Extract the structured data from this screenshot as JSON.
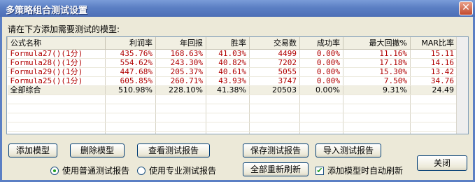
{
  "window": {
    "title": "多策略组合测试设置",
    "close_glyph": "✕"
  },
  "prompt": "请在下方添加需要测试的模型:",
  "table": {
    "columns": [
      "公式名称",
      "利润率",
      "年回报",
      "胜率",
      "交易数",
      "成功率",
      "最大回撤%",
      "MAR比率"
    ],
    "rows": [
      [
        "Formula27()(1分)",
        "435.76%",
        "168.63%",
        "41.03%",
        "4499",
        "0.00%",
        "11.16%",
        "15.11"
      ],
      [
        "Formula28()(1分)",
        "554.62%",
        "243.30%",
        "40.82%",
        "7202",
        "0.00%",
        "17.18%",
        "14.16"
      ],
      [
        "Formula29()(1分)",
        "447.68%",
        "205.37%",
        "40.61%",
        "5055",
        "0.00%",
        "15.30%",
        "13.42"
      ],
      [
        "Formula25()(1分)",
        "605.85%",
        "260.71%",
        "43.93%",
        "3747",
        "0.00%",
        "7.50%",
        "34.76"
      ]
    ],
    "summary": [
      "全部综合",
      "510.98%",
      "228.10%",
      "41.38%",
      "20503",
      "0.00%",
      "9.31%",
      "24.49"
    ]
  },
  "buttons": {
    "add_model": "添加模型",
    "delete_model": "删除模型",
    "view_report": "查看测试报告",
    "save_report": "保存测试报告",
    "import_report": "导入测试报告",
    "refresh_all": "全部重新刷新",
    "close": "关闭"
  },
  "options": {
    "normal_report": "使用普通测试报告",
    "pro_report": "使用专业测试报告",
    "auto_refresh": "添加模型时自动刷新",
    "normal_selected": true,
    "auto_refresh_checked": true
  }
}
